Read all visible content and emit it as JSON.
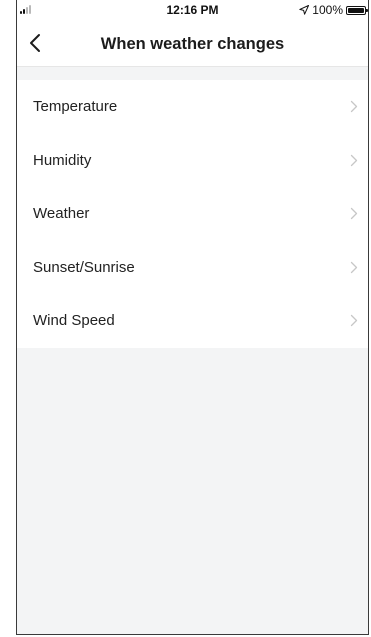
{
  "status_bar": {
    "time": "12:16 PM",
    "battery": "100%",
    "signal_icon": "cellular-signal-icon",
    "location_icon": "location-arrow-icon",
    "battery_icon": "battery-full-icon"
  },
  "nav": {
    "title": "When weather changes",
    "back_icon": "chevron-left-icon"
  },
  "options": [
    {
      "label": "Temperature",
      "icon": "chevron-right-icon"
    },
    {
      "label": "Humidity",
      "icon": "chevron-right-icon"
    },
    {
      "label": "Weather",
      "icon": "chevron-right-icon"
    },
    {
      "label": "Sunset/Sunrise",
      "icon": "chevron-right-icon"
    },
    {
      "label": "Wind Speed",
      "icon": "chevron-right-icon"
    }
  ],
  "colors": {
    "background": "#f3f4f5",
    "surface": "#ffffff",
    "text": "#222222",
    "chevron": "#c7c7c7"
  }
}
